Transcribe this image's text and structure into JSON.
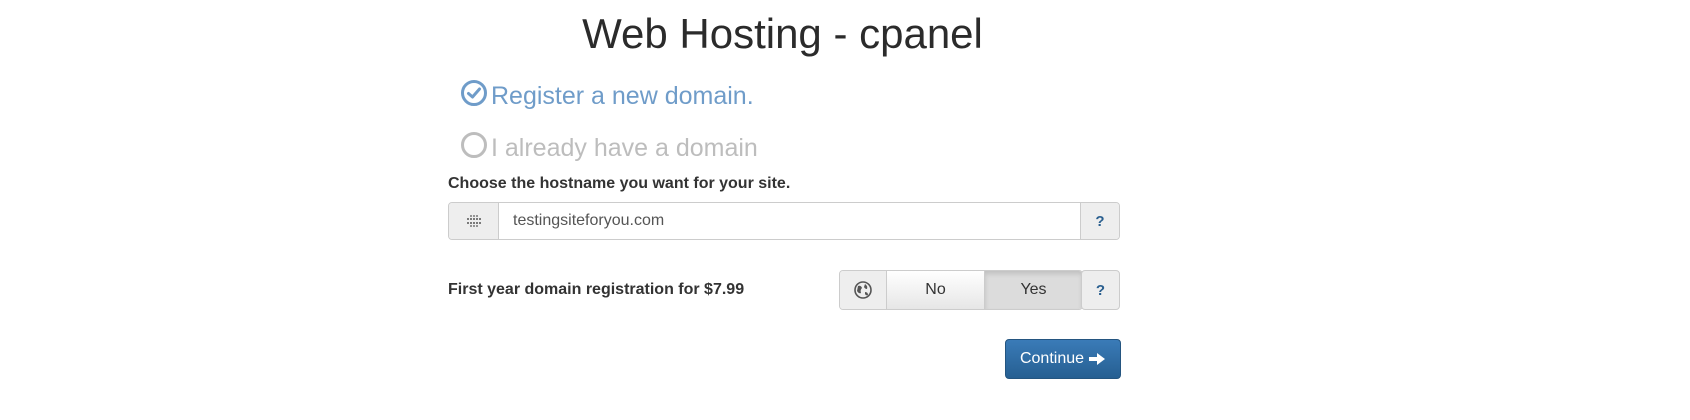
{
  "page": {
    "title": "Web Hosting - cpanel"
  },
  "domain_options": {
    "register_label": "Register a new domain.",
    "existing_label": "I already have a domain",
    "selected": "register"
  },
  "hostname": {
    "label": "Choose the hostname you want for your site.",
    "value": "testingsiteforyou.com",
    "help": "?",
    "icon": "globe-grid-icon"
  },
  "registration": {
    "label": "First year domain registration for $7.99",
    "no_label": "No",
    "yes_label": "Yes",
    "selected": "Yes",
    "help": "?",
    "icon": "globe-icon"
  },
  "actions": {
    "continue_label": "Continue",
    "continue_icon": "arrow-right-icon"
  },
  "colors": {
    "selected_option": "#6f9cc9",
    "unselected_option": "#bdbdbd",
    "primary_button": "#2e6da4",
    "help_text": "#2a5f8f"
  }
}
